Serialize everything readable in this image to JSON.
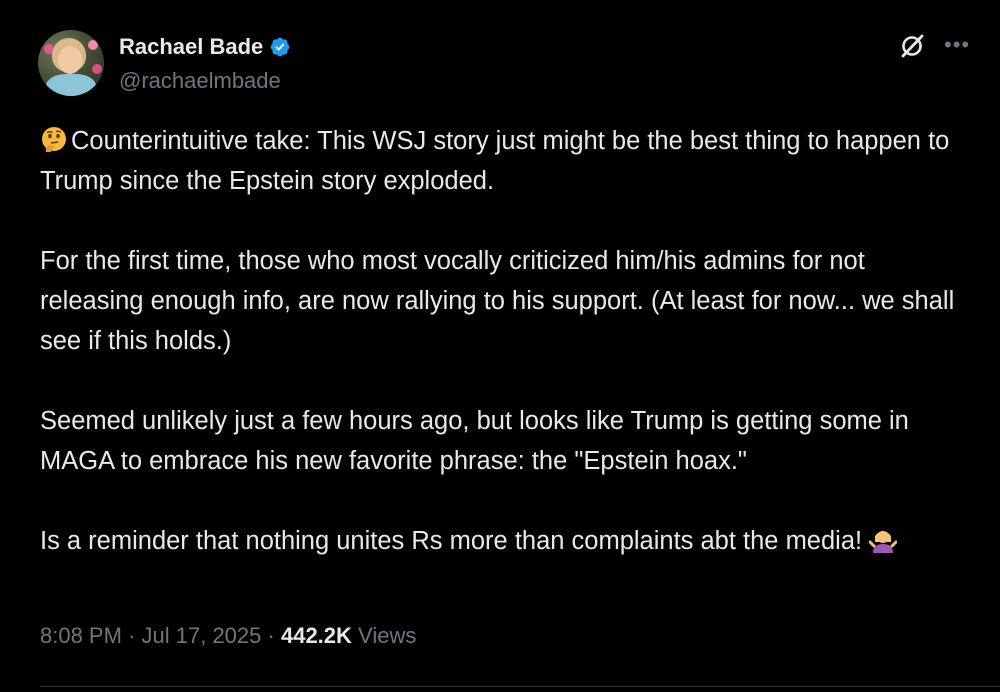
{
  "author": {
    "name": "Rachael Bade",
    "handle": "@rachaelmbade",
    "verified": true,
    "badge_color": "#1d9bf0"
  },
  "icons": {
    "verified": "verified-badge-icon",
    "grok": "grok-icon",
    "more": "more-options-icon",
    "thinking": "thinking-face-emoji",
    "shrug": "woman-shrugging-emoji"
  },
  "tweet": {
    "para1": "Counterintuitive take: This WSJ story just might be the best thing to happen to Trump since the Epstein story exploded.",
    "para2": "For the first time, those who most vocally criticized him/his admins for not releasing enough info, are now rallying to his support. (At least for now... we shall see if this holds.)",
    "para3": "Seemed unlikely just a few hours ago, but looks like Trump is getting some in MAGA to embrace his new favorite phrase: the \"Epstein hoax.\"",
    "para4": "Is a reminder that nothing unites Rs more than complaints abt the media!"
  },
  "meta": {
    "time": "8:08 PM",
    "separator": "·",
    "date": "Jul 17, 2025",
    "views_count": "442.2K",
    "views_label": "Views"
  },
  "colors": {
    "background": "#000000",
    "text": "#e7e9ea",
    "secondary": "#71767b"
  }
}
